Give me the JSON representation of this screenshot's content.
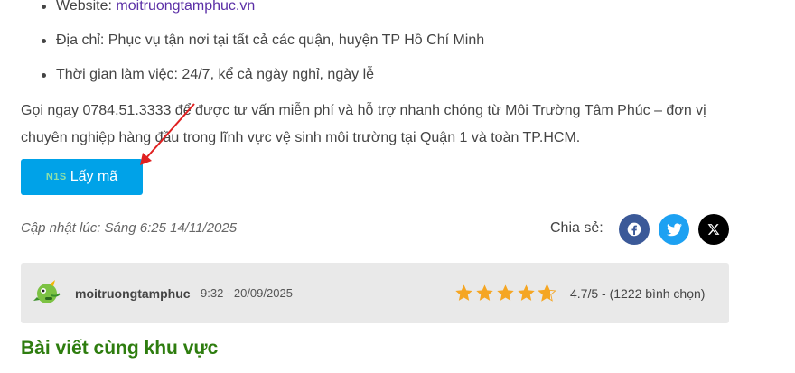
{
  "bullets": [
    {
      "label": "Website: ",
      "link": "moitruongtamphuc.vn"
    },
    {
      "label": "Địa chỉ: Phục vụ tận nơi tại tất cả các quận, huyện TP Hồ Chí Minh"
    },
    {
      "label": "Thời gian làm việc: 24/7, kể cả ngày nghỉ, ngày lễ"
    }
  ],
  "paragraph": "Gọi ngay 0784.51.3333 để được tư vấn miễn phí và hỗ trợ nhanh chóng từ Môi Trường Tâm Phúc – đơn vị chuyên nghiệp hàng đầu trong lĩnh vực vệ sinh môi trường tại Quận 1 và toàn TP.HCM.",
  "button": {
    "logo": "N1S",
    "label": "Lấy mã",
    "color": "#00a2e8"
  },
  "updated": "Cập nhật lúc: Sáng 6:25 14/11/2025",
  "share": {
    "label": "Chia sẻ:",
    "icons": [
      "facebook-icon",
      "twitter-icon",
      "x-icon"
    ]
  },
  "author": {
    "name": "moitruongtamphuc",
    "time": "9:32 - 20/09/2025",
    "stars": 4.7,
    "rating_text": "4.7/5 - (1222 bình chọn)"
  },
  "section_title": "Bài viết cùng khu vực",
  "colors": {
    "accent": "#00a2e8",
    "link": "#5b2fa6",
    "heading": "#2e7d0f",
    "star": "#f5a623"
  }
}
